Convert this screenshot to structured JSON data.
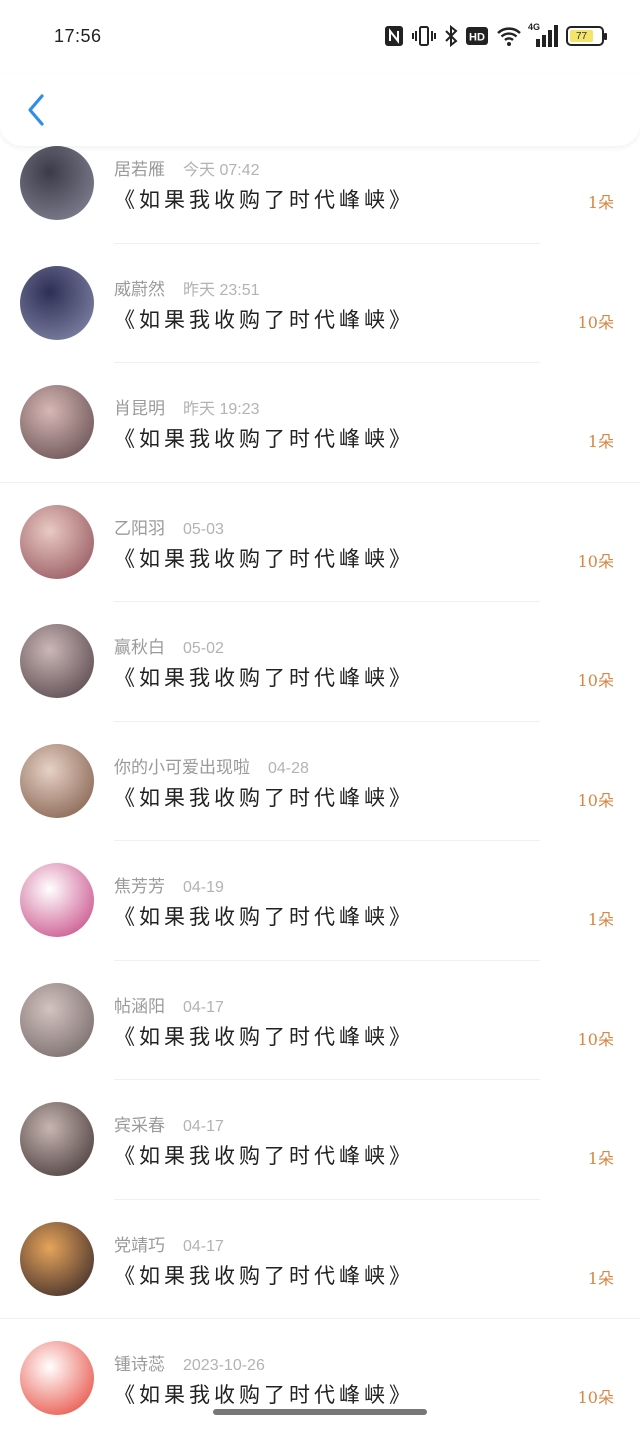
{
  "status_bar": {
    "time": "17:56",
    "network": "4G",
    "battery": "77",
    "icons": [
      "nfc-icon",
      "vibrate-icon",
      "bluetooth-icon",
      "hd-icon",
      "wifi-icon",
      "signal-icon",
      "battery-icon"
    ]
  },
  "header": {
    "back_icon": "chevron-left-icon"
  },
  "colors": {
    "accent": "#2f8ee6",
    "amount": "#d88642",
    "meta": "#9a9a9a"
  },
  "items": [
    {
      "name": "居若雁",
      "date": "今天 07:42",
      "book": "《如果我收购了时代峰峡》",
      "amount": "1朵"
    },
    {
      "name": "威蔚然",
      "date": "昨天 23:51",
      "book": "《如果我收购了时代峰峡》",
      "amount": "10朵"
    },
    {
      "name": "肖昆明",
      "date": "昨天 19:23",
      "book": "《如果我收购了时代峰峡》",
      "amount": "1朵"
    },
    {
      "name": "乙阳羽",
      "date": "05-03",
      "book": "《如果我收购了时代峰峡》",
      "amount": "10朵"
    },
    {
      "name": "赢秋白",
      "date": "05-02",
      "book": "《如果我收购了时代峰峡》",
      "amount": "10朵"
    },
    {
      "name": "你的小可爱出现啦",
      "date": "04-28",
      "book": "《如果我收购了时代峰峡》",
      "amount": "10朵"
    },
    {
      "name": "焦芳芳",
      "date": "04-19",
      "book": "《如果我收购了时代峰峡》",
      "amount": "1朵"
    },
    {
      "name": "帖涵阳",
      "date": "04-17",
      "book": "《如果我收购了时代峰峡》",
      "amount": "10朵"
    },
    {
      "name": "宾采春",
      "date": "04-17",
      "book": "《如果我收购了时代峰峡》",
      "amount": "1朵"
    },
    {
      "name": "党靖巧",
      "date": "04-17",
      "book": "《如果我收购了时代峰峡》",
      "amount": "1朵"
    },
    {
      "name": "锺诗蕊",
      "date": "2023-10-26",
      "book": "《如果我收购了时代峰峡》",
      "amount": "10朵"
    }
  ]
}
